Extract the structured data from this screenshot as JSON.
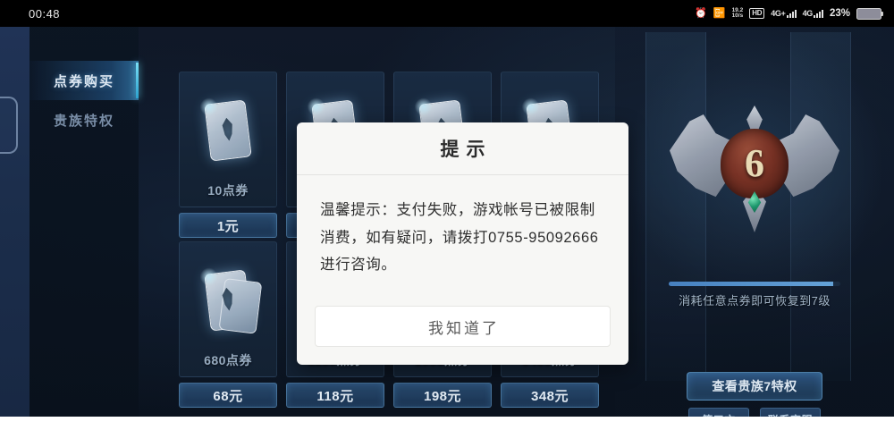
{
  "statusbar": {
    "clock": "00:48",
    "icons": [
      "alarm-icon",
      "vibrate-icon",
      "dual-sim-icon",
      "hd-icon",
      "4g-plus-icon",
      "4g-icon"
    ],
    "hd_label": "HD",
    "hd_sim": "1",
    "hd_sim2": "2",
    "net_primary": "4G+",
    "net_secondary": "4G",
    "dual_top": "19.2",
    "dual_bottom": "10/s",
    "battery_percent": "23%"
  },
  "sidebar": {
    "items": [
      {
        "label": "点券购买",
        "active": true
      },
      {
        "label": "贵族特权",
        "active": false
      }
    ]
  },
  "shop": {
    "cards": [
      {
        "amount": "",
        "price": "",
        "hidden": true,
        "stack": false
      },
      {
        "amount": "",
        "price": "",
        "hidden": true,
        "stack": false
      },
      {
        "amount": "",
        "price": "",
        "hidden": true,
        "stack": false
      },
      {
        "amount": "",
        "price": "",
        "hidden": true,
        "stack": false
      },
      {
        "amount": "680点券",
        "price": "68元",
        "hidden": false,
        "stack": true
      },
      {
        "amount": "1180点券",
        "price": "118元",
        "hidden": false,
        "stack": true
      },
      {
        "amount": "1980点券",
        "price": "198元",
        "hidden": false,
        "stack": true
      },
      {
        "amount": "3480点券",
        "price": "348元",
        "hidden": false,
        "stack": true
      }
    ],
    "first_card": {
      "amount": "10点券",
      "price": "1元"
    }
  },
  "noble": {
    "level": "6",
    "hint": "消耗任意点券即可恢复到7级",
    "privilege_button": "查看贵族7特权",
    "third_party_button": "第三方",
    "support_button": "联系客服"
  },
  "dialog": {
    "title": "提示",
    "message": "温馨提示：支付失败，游戏帐号已被限制消费，如有疑问，请拨打0755-95092666进行咨询。",
    "confirm_label": "我知道了"
  },
  "colors": {
    "accent_cyan": "#7fe8ff",
    "panel_blue": "#1b2d45",
    "dialog_bg": "#f7f7f5",
    "gem_green": "#1f9d72",
    "emblem_red": "#7b3326"
  }
}
